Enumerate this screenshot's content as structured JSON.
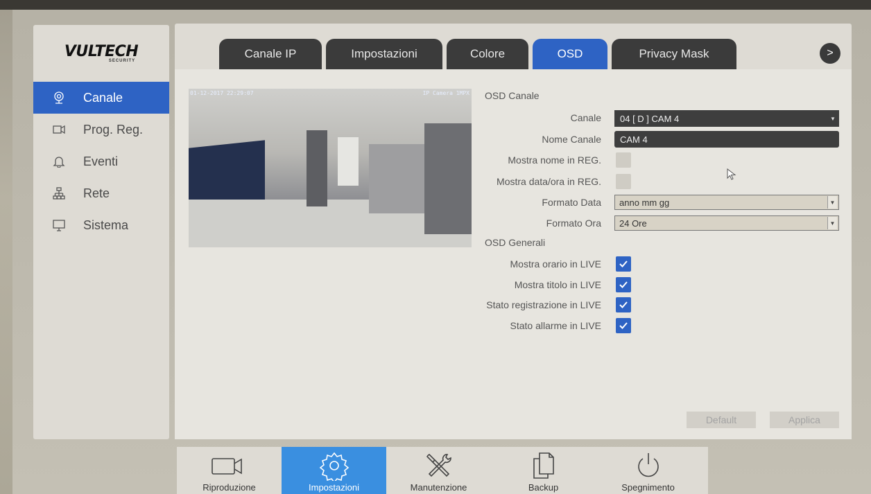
{
  "app": {
    "logo_text": "VULTECH",
    "logo_subtext": "SECURITY"
  },
  "sidebar": {
    "items": [
      {
        "label": "Canale",
        "icon": "webcam-icon",
        "active": true
      },
      {
        "label": "Prog. Reg.",
        "icon": "video-camera-icon",
        "active": false
      },
      {
        "label": "Eventi",
        "icon": "bell-icon",
        "active": false
      },
      {
        "label": "Rete",
        "icon": "network-icon",
        "active": false
      },
      {
        "label": "Sistema",
        "icon": "monitor-icon",
        "active": false
      }
    ]
  },
  "tabs": [
    {
      "label": "Canale IP",
      "active": false
    },
    {
      "label": "Impostazioni",
      "active": false
    },
    {
      "label": "Colore",
      "active": false
    },
    {
      "label": "OSD",
      "active": true
    },
    {
      "label": "Privacy Mask",
      "active": false
    }
  ],
  "tabs_next": ">",
  "preview": {
    "timestamp": "01-12-2017 22:29:07",
    "camera_label": "IP Camera 1MPX"
  },
  "osd_canale": {
    "section_title": "OSD Canale",
    "canale_label": "Canale",
    "canale_value": "04 [ D ] CAM 4",
    "nome_canale_label": "Nome Canale",
    "nome_canale_value": "CAM 4",
    "mostra_nome_label": "Mostra nome in REG.",
    "mostra_nome_checked": false,
    "mostra_data_label": "Mostra data/ora in REG.",
    "mostra_data_checked": false,
    "formato_data_label": "Formato Data",
    "formato_data_value": "anno mm gg",
    "formato_ora_label": "Formato Ora",
    "formato_ora_value": "24 Ore"
  },
  "osd_generali": {
    "section_title": "OSD Generali",
    "items": [
      {
        "label": "Mostra orario in LIVE",
        "checked": true
      },
      {
        "label": "Mostra titolo in LIVE",
        "checked": true
      },
      {
        "label": "Stato registrazione in LIVE",
        "checked": true
      },
      {
        "label": "Stato allarme in LIVE",
        "checked": true
      }
    ]
  },
  "buttons": {
    "default_label": "Default",
    "apply_label": "Applica"
  },
  "dock": [
    {
      "label": "Riproduzione",
      "icon": "video-camera-icon",
      "active": false
    },
    {
      "label": "Impostazioni",
      "icon": "gear-icon",
      "active": true
    },
    {
      "label": "Manutenzione",
      "icon": "tools-icon",
      "active": false
    },
    {
      "label": "Backup",
      "icon": "documents-icon",
      "active": false
    },
    {
      "label": "Spegnimento",
      "icon": "power-icon",
      "active": false
    }
  ],
  "colors": {
    "accent": "#2e63c4",
    "dock_active": "#3a8fe0",
    "tab_inactive": "#3b3b3b"
  }
}
